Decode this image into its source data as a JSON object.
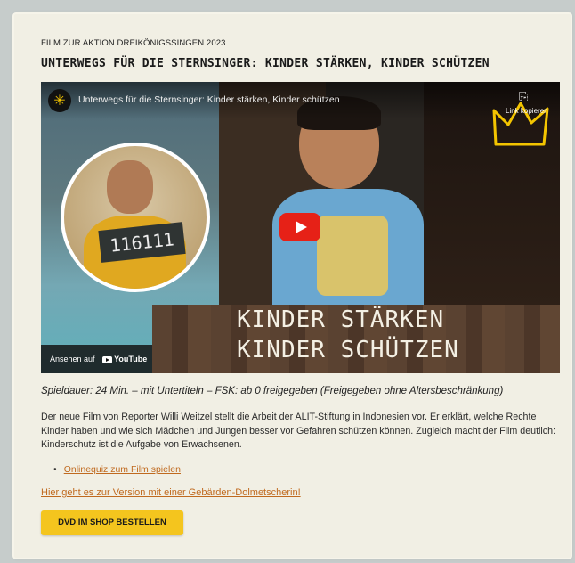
{
  "kicker": "FILM ZUR AKTION DREIKÖNIGSSINGEN 2023",
  "headline": "UNTERWEGS FÜR DIE STERNSINGER: KINDER STÄRKEN, KINDER SCHÜTZEN",
  "video": {
    "title": "Unterwegs für die Sternsinger: Kinder stärken, Kinder schützen",
    "share_label": "Link kopieren",
    "slate_number": "116111",
    "overlay_line1": "KINDER STÄRKEN",
    "overlay_line2": "KINDER SCHÜTZEN",
    "watch_on": "Ansehen auf",
    "yt_brand": "YouTube"
  },
  "meta": "Spieldauer: 24 Min. – mit Untertiteln – FSK: ab 0 freigegeben (Freigegeben ohne Altersbeschränkung)",
  "description": "Der neue Film von Reporter Willi Weitzel stellt die Arbeit der ALIT-Stiftung in Indonesien vor. Er erklärt, welche Rechte Kinder haben und wie sich Mädchen und Jungen besser vor Gefahren schützen können. Zugleich macht der Film deutlich: Kinderschutz ist die Aufgabe von Erwachsenen.",
  "quiz_link": "Onlinequiz zum Film spielen",
  "sign_link": "Hier geht es zur Version mit einer Gebärden-Dolmetscherin!",
  "buy_button": "DVD IM SHOP BESTELLEN",
  "colors": {
    "accent": "#f4c51e",
    "link": "#c06a1f",
    "yt_red": "#e62117",
    "card_bg": "#f1efe4"
  }
}
